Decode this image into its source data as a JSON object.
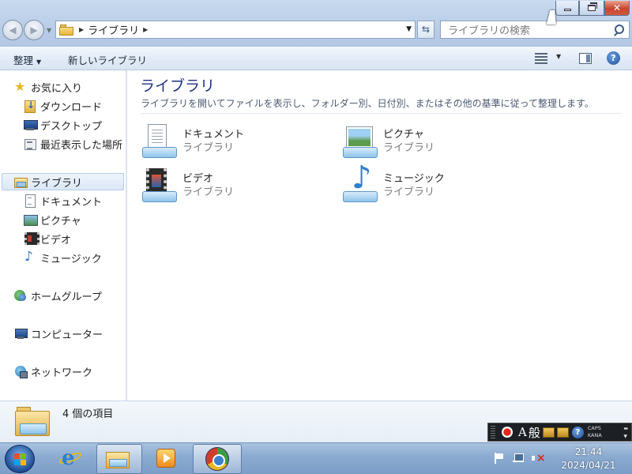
{
  "window": {
    "controls": {
      "minimize": "minimize",
      "maximize": "restore",
      "close": "close"
    }
  },
  "navbar": {
    "address_path": "ライブラリ",
    "search_placeholder": "ライブラリの検索"
  },
  "commandbar": {
    "organize_label": "整理",
    "new_library_label": "新しいライブラリ"
  },
  "sidebar": {
    "favorites": {
      "header": "お気に入り",
      "items": [
        "ダウンロード",
        "デスクトップ",
        "最近表示した場所"
      ]
    },
    "libraries": {
      "header": "ライブラリ",
      "items": [
        "ドキュメント",
        "ピクチャ",
        "ビデオ",
        "ミュージック"
      ]
    },
    "homegroup": "ホームグループ",
    "computer": "コンピューター",
    "network": "ネットワーク"
  },
  "main": {
    "title": "ライブラリ",
    "description": "ライブラリを開いてファイルを表示し、フォルダー別、日付別、またはその他の基準に従って整理します。",
    "libraries": [
      {
        "name": "ドキュメント",
        "type": "ライブラリ",
        "icon": "documents-library-icon"
      },
      {
        "name": "ピクチャ",
        "type": "ライブラリ",
        "icon": "pictures-library-icon"
      },
      {
        "name": "ビデオ",
        "type": "ライブラリ",
        "icon": "videos-library-icon"
      },
      {
        "name": "ミュージック",
        "type": "ライブラリ",
        "icon": "music-library-icon"
      }
    ]
  },
  "details": {
    "item_count": "4 個の項目"
  },
  "langbar": {
    "input_mode": "A",
    "kanji_mode": "般",
    "caps": "CAPS",
    "kana": "KANA"
  },
  "taskbar": {
    "time": "21:44",
    "date": "2024/04/21"
  },
  "colors": {
    "title_text": "#1e3287",
    "taskbar": "#8aaad0",
    "close_button": "#c8452c"
  }
}
